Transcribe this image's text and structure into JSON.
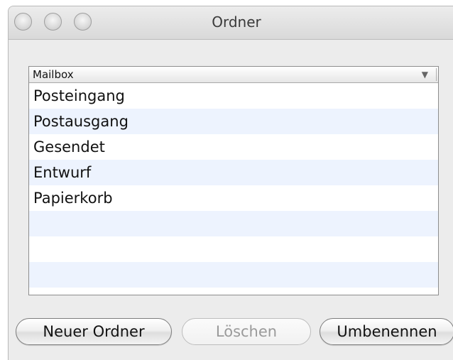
{
  "window": {
    "title": "Ordner"
  },
  "table": {
    "column_header": "Mailbox",
    "sort_indicator": "▼",
    "rows": [
      "Posteingang",
      "Postausgang",
      "Gesendet",
      "Entwurf",
      "Papierkorb",
      "",
      "",
      ""
    ]
  },
  "buttons": {
    "new_folder": "Neuer Ordner",
    "delete": "Löschen",
    "rename": "Umbenennen"
  },
  "states": {
    "delete_enabled": false
  },
  "colors": {
    "alt_row": "#edf3fe",
    "window_bg": "#ececec"
  }
}
